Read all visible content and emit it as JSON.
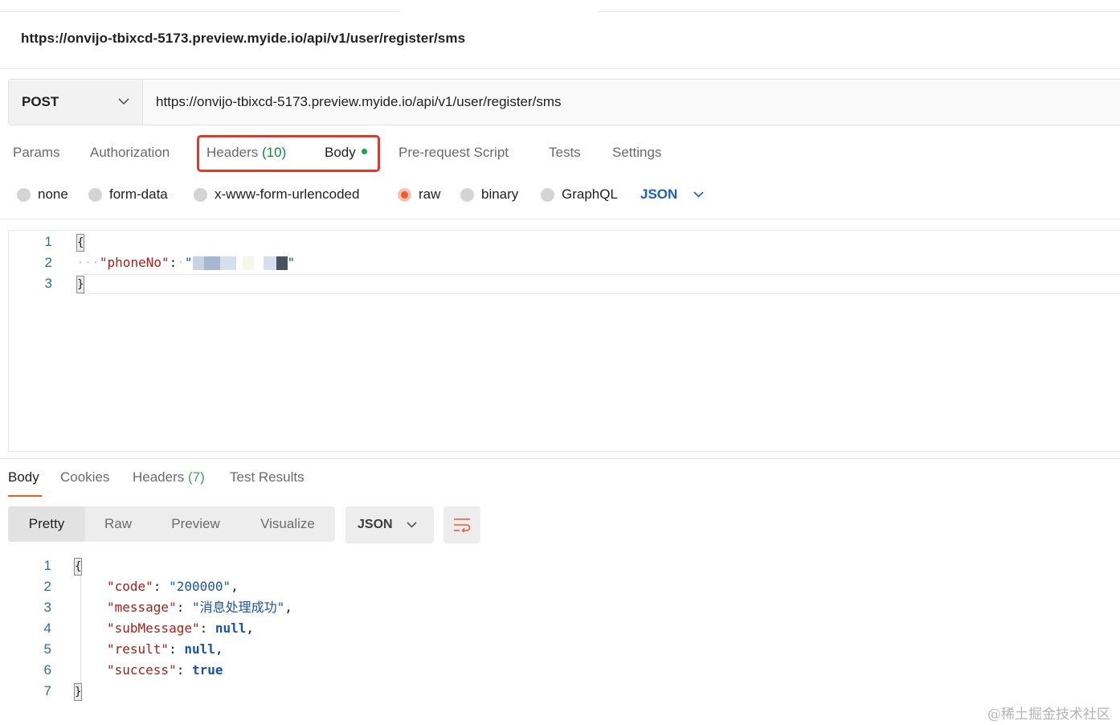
{
  "request": {
    "title": "https://onvijo-tbixcd-5173.preview.myide.io/api/v1/user/register/sms",
    "method": "POST",
    "url": "https://onvijo-tbixcd-5173.preview.myide.io/api/v1/user/register/sms"
  },
  "request_tabs": {
    "params": "Params",
    "authorization": "Authorization",
    "headers": "Headers",
    "headers_count": "(10)",
    "body": "Body",
    "pre_request": "Pre-request Script",
    "tests": "Tests",
    "settings": "Settings"
  },
  "body_types": {
    "none": "none",
    "form_data": "form-data",
    "urlencoded": "x-www-form-urlencoded",
    "raw": "raw",
    "binary": "binary",
    "graphql": "GraphQL",
    "selected": "raw",
    "language": "JSON"
  },
  "request_body": {
    "line_numbers": [
      "1",
      "2",
      "3"
    ],
    "open_brace": "{",
    "key": "\"phoneNo\"",
    "colon": ":",
    "value_open_quote": "\"",
    "value_close_quote": "\"",
    "close_brace": "}"
  },
  "response_tabs": {
    "body": "Body",
    "cookies": "Cookies",
    "headers": "Headers",
    "headers_count": "(7)",
    "test_results": "Test Results"
  },
  "response_view": {
    "pretty": "Pretty",
    "raw": "Raw",
    "preview": "Preview",
    "visualize": "Visualize",
    "format": "JSON"
  },
  "response_body": {
    "line_numbers": [
      "1",
      "2",
      "3",
      "4",
      "5",
      "6",
      "7"
    ],
    "open_brace": "{",
    "close_brace": "}",
    "code_key": "\"code\"",
    "code_value": "\"200000\"",
    "message_key": "\"message\"",
    "message_value": "\"消息处理成功\"",
    "submessage_key": "\"subMessage\"",
    "submessage_value": "null",
    "result_key": "\"result\"",
    "result_value": "null",
    "success_key": "\"success\"",
    "success_value": "true",
    "colon": ":",
    "comma": ","
  },
  "watermark": "@稀土掘金技术社区",
  "colors": {
    "accent": "#ef5b2c",
    "highlight_box": "#dc3a2f",
    "json_key": "#a3221a",
    "json_value": "#1a53a8",
    "count_green": "#0d8a3c"
  }
}
